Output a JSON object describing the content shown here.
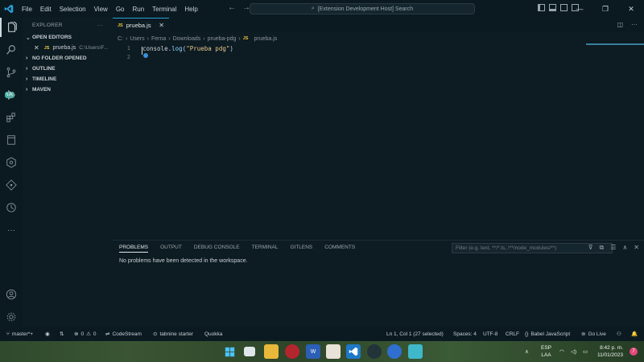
{
  "titlebar": {
    "menu": [
      "File",
      "Edit",
      "Selection",
      "View",
      "Go",
      "Run",
      "Terminal",
      "Help"
    ],
    "command_center": "[Extension Development Host] Search"
  },
  "activity_bar": {
    "items": [
      "explorer-icon",
      "search-icon",
      "source-control-icon",
      "run-debug-icon",
      "extensions-icon",
      "notebook-icon",
      "gitlens-icon",
      "remote-icon",
      "timer-icon",
      "more-icon"
    ],
    "badge": "WK",
    "bottom": [
      "account-icon",
      "settings-gear-icon"
    ]
  },
  "sidebar": {
    "title": "EXPLORER",
    "more": "···",
    "open_editors": "OPEN EDITORS",
    "open_file": "prueba.js",
    "open_file_path": "C:\\Users\\F...",
    "no_folder": "NO FOLDER OPENED",
    "outline": "OUTLINE",
    "timeline": "TIMELINE",
    "maven": "MAVEN"
  },
  "editor": {
    "tab_label": "prueba.js",
    "breadcrumb": [
      "C:",
      "Users",
      "Ferna",
      "Downloads",
      "prueba-pdg",
      "prueba.js"
    ],
    "line_numbers": [
      "1",
      "2"
    ],
    "code": {
      "obj": "console",
      "dot": ".",
      "fn": "log",
      "open": "(",
      "str": "\"Prueba pdg\"",
      "close": ")"
    }
  },
  "panel": {
    "tabs": [
      "PROBLEMS",
      "OUTPUT",
      "DEBUG CONSOLE",
      "TERMINAL",
      "GITLENS",
      "COMMENTS"
    ],
    "active_tab": "PROBLEMS",
    "filter_placeholder": "Filter (e.g. text, **/*.ts, !**/node_modules/**)",
    "message": "No problems have been detected in the workspace."
  },
  "statusbar": {
    "branch": "master*+",
    "errors": "0",
    "warnings": "0",
    "codestream": "CodeStream",
    "tabnine": "tabnine starter",
    "quokka": "Quokka",
    "position": "Ln 1, Col 1 (27 selected)",
    "spaces": "Spaces: 4",
    "encoding": "UTF-8",
    "eol": "CRLF",
    "language": "Babel JavaScript",
    "golive": "Go Live"
  },
  "taskbar": {
    "lang_line1": "ESP",
    "lang_line2": "LAA",
    "time": "8:42 p. m.",
    "date": "11/01/2023",
    "notification_count": "7"
  },
  "colors": {
    "accent": "#2a9fd6",
    "js_icon": "#e9c73c",
    "string": "#e6c88b",
    "property": "#8fd3ff"
  }
}
